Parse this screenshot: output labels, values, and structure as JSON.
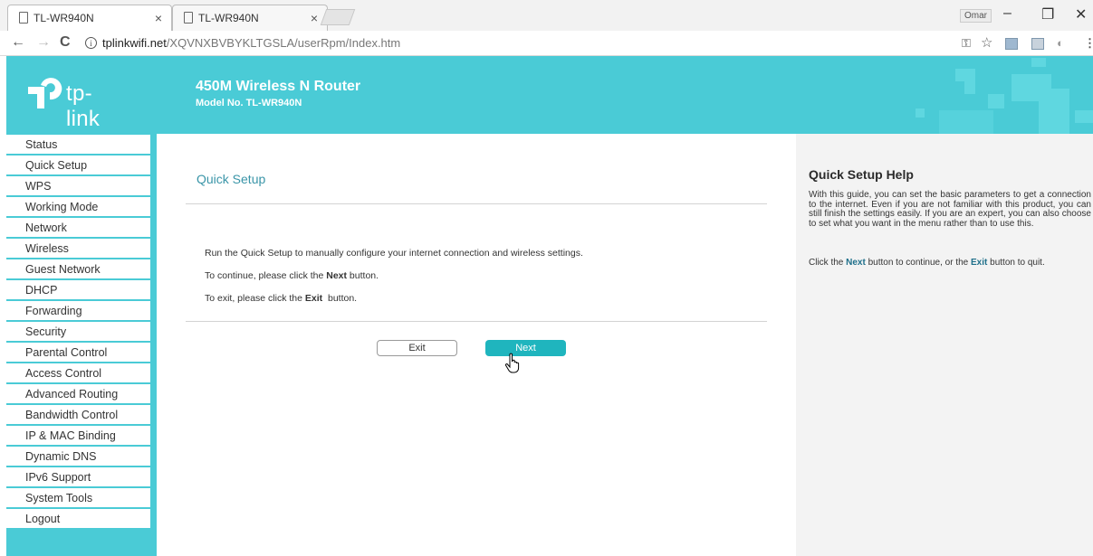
{
  "browser": {
    "tabs": [
      {
        "title": "TL-WR940N",
        "close": "×"
      },
      {
        "title": "TL-WR940N",
        "close": "×"
      }
    ],
    "user": "Omar",
    "window_controls": {
      "minimize": "–",
      "restore": "❐",
      "close": "✕"
    },
    "url_host": "tplinkwifi.net",
    "url_path": "/XQVNXBVBYKLTGSLA/userRpm/Index.htm"
  },
  "header": {
    "logo_text": "tp-link",
    "product": "450M Wireless N Router",
    "model": "Model No. TL-WR940N"
  },
  "menu": {
    "items": [
      "Status",
      "Quick Setup",
      "WPS",
      "Working Mode",
      "Network",
      "Wireless",
      "Guest Network",
      "DHCP",
      "Forwarding",
      "Security",
      "Parental Control",
      "Access Control",
      "Advanced Routing",
      "Bandwidth Control",
      "IP & MAC Binding",
      "Dynamic DNS",
      "IPv6 Support",
      "System Tools",
      "Logout"
    ]
  },
  "main": {
    "title": "Quick Setup",
    "line1": "Run the Quick Setup to manually configure your internet connection and wireless settings.",
    "line2_pre": "To continue, please click the ",
    "line2_bold": "Next",
    "line2_post": " button.",
    "line3_pre": "To exit, please click the ",
    "line3_bold": "Exit",
    "line3_post": "  button.",
    "exit_label": "Exit",
    "next_label": "Next"
  },
  "help": {
    "title": "Quick Setup Help",
    "text": "With this guide, you can set the basic parameters to get a connection to the internet. Even if you are not familiar with this product, you can still finish the settings easily. If you are an expert, you can also choose to set what you want in the menu rather than to use this.",
    "line2_pre": "Click the ",
    "line2_next": "Next",
    "line2_mid": " button to continue, or the ",
    "line2_exit": "Exit",
    "line2_post": " button to quit."
  },
  "colors": {
    "accent": "#4acbd6",
    "button": "#1fb5be",
    "title": "#3a95a8"
  }
}
